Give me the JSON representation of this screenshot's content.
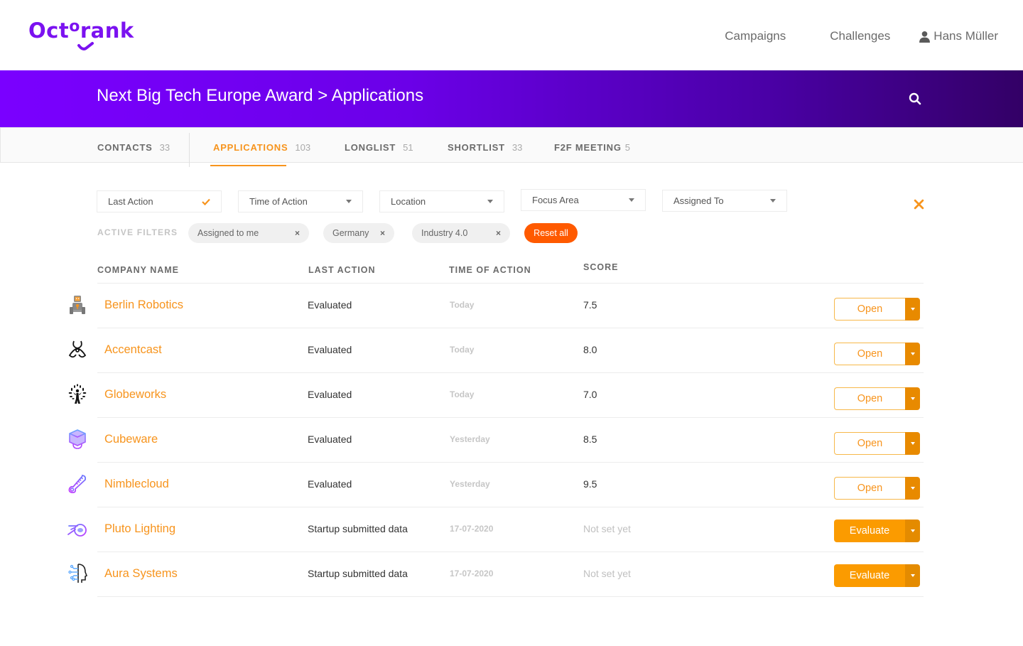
{
  "app": {
    "logo_text_a": "Oct",
    "logo_text_o": "o",
    "logo_text_b": "rank",
    "brand_color": "#7b12f0",
    "accent_color": "#f7941d",
    "reset_color": "#ff5a00"
  },
  "topnav": {
    "items": [
      {
        "label": "Campaigns"
      },
      {
        "label": "Challenges"
      }
    ],
    "user": {
      "icon": "user-icon",
      "name": "Hans Müller"
    }
  },
  "banner": {
    "title": "Next Big Tech Europe Award > Applications",
    "search_icon": "search-icon"
  },
  "tabs": [
    {
      "label": "CONTACTS",
      "count": "33",
      "active": false
    },
    {
      "label": "APPLICATIONS",
      "count": "103",
      "active": true
    },
    {
      "label": "LONGLIST",
      "count": "51",
      "active": false
    },
    {
      "label": "SHORTLIST",
      "count": "33",
      "active": false
    },
    {
      "label": "F2F MEETING",
      "count": "5",
      "active": false
    }
  ],
  "filters": {
    "selects": [
      {
        "label": "Last Action",
        "state": "checked"
      },
      {
        "label": "Time of Action",
        "state": "collapsed"
      },
      {
        "label": "Location",
        "state": "collapsed"
      },
      {
        "label": "Focus Area",
        "state": "collapsed"
      },
      {
        "label": "Assigned To",
        "state": "collapsed"
      }
    ],
    "active_label": "ACTIVE FILTERS",
    "chips": [
      {
        "label": "Assigned to me",
        "remove": "×"
      },
      {
        "label": "Germany",
        "remove": "×"
      },
      {
        "label": "Industry 4.0",
        "remove": "×"
      }
    ],
    "reset_label": "Reset all",
    "close_icon": "close-icon"
  },
  "table": {
    "headers": {
      "company": "COMPANY NAME",
      "last_action": "LAST ACTION",
      "time": "TIME OF ACTION",
      "score": "SCORE"
    },
    "rows": [
      {
        "icon": "robot-icon",
        "company": "Berlin Robotics",
        "last_action": "Evaluated",
        "time": "Today",
        "score": "7.5",
        "button": "Open",
        "button_style": "outline"
      },
      {
        "icon": "biohazard-icon",
        "company": "Accentcast",
        "last_action": "Evaluated",
        "time": "Today",
        "score": "8.0",
        "button": "Open",
        "button_style": "outline"
      },
      {
        "icon": "tree-person-icon",
        "company": "Globeworks",
        "last_action": "Evaluated",
        "time": "Today",
        "score": "7.0",
        "button": "Open",
        "button_style": "outline"
      },
      {
        "icon": "cube-icon",
        "company": "Cubeware",
        "last_action": "Evaluated",
        "time": "Yesterday",
        "score": "8.5",
        "button": "Open",
        "button_style": "outline"
      },
      {
        "icon": "thermometer-icon",
        "company": "Nimblecloud",
        "last_action": "Evaluated",
        "time": "Yesterday",
        "score": "9.5",
        "button": "Open",
        "button_style": "outline"
      },
      {
        "icon": "blender-icon",
        "company": "Pluto Lighting",
        "last_action": "Startup submitted data",
        "time": "17-07-2020",
        "score": "Not set yet",
        "button": "Evaluate",
        "button_style": "solid"
      },
      {
        "icon": "ai-head-icon",
        "company": "Aura Systems",
        "last_action": "Startup submitted data",
        "time": "17-07-2020",
        "score": "Not set yet",
        "button": "Evaluate",
        "button_style": "solid"
      }
    ]
  }
}
